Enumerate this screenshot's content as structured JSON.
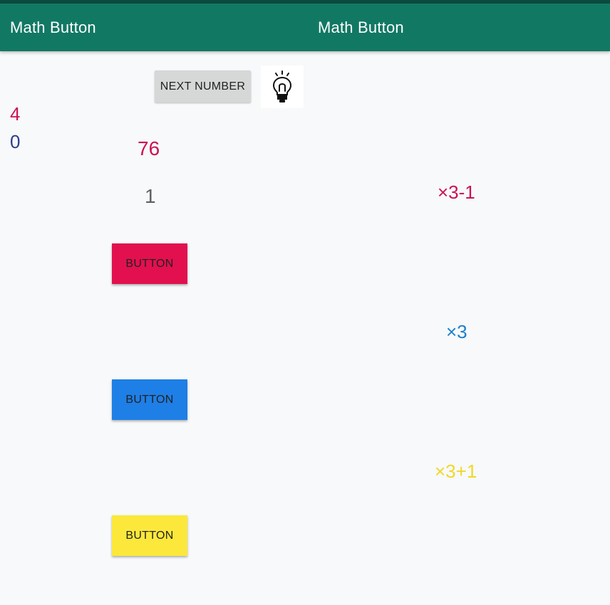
{
  "appbar": {
    "title_left": "Math Button",
    "title_center": "Math Button"
  },
  "toolbar": {
    "next_label": "NEXT NUMBER",
    "hint_icon": "lightbulb-icon"
  },
  "scores": {
    "correct": "4",
    "wrong": "0"
  },
  "game": {
    "target": "76",
    "current": "1"
  },
  "buttons": [
    {
      "label": "BUTTON",
      "operation": "×3-1",
      "color": "#e2104f"
    },
    {
      "label": "BUTTON",
      "operation": "×3",
      "color": "#1e7fe6"
    },
    {
      "label": "BUTTON",
      "operation": "×3+1",
      "color": "#fce83a"
    }
  ],
  "colors": {
    "appbar": "#117864",
    "correct_score": "#cc1155",
    "wrong_score": "#2a3d8f",
    "op1_label": "#cc1155",
    "op2_label": "#1e7fcc",
    "op3_label": "#f0d828"
  }
}
